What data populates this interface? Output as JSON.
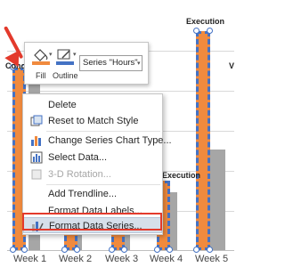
{
  "chart": {
    "categories": [
      "Week 1",
      "Week 2",
      "Week 3",
      "Week 4",
      "Week 5"
    ],
    "series_labels": [
      "Execution",
      "Execution"
    ],
    "clipped_labels": [
      "Conce",
      "V"
    ],
    "colors": {
      "hours_series": "#f08a3e",
      "gray_series": "#a6a6a6",
      "selection": "#4472c4"
    }
  },
  "mini_toolbar": {
    "fill_label": "Fill",
    "outline_label": "Outline",
    "series_select_value": "Series \"Hours\"",
    "icons": [
      "paint-bucket-icon",
      "pen-outline-icon",
      "chevron-down-icon"
    ]
  },
  "context_menu": {
    "items": [
      {
        "label": "Delete",
        "icon": "",
        "disabled": false
      },
      {
        "label": "Reset to Match Style",
        "icon": "reset-style-icon",
        "disabled": false
      },
      {
        "label": "Change Series Chart Type...",
        "icon": "chart-type-icon",
        "disabled": false
      },
      {
        "label": "Select Data...",
        "icon": "select-data-icon",
        "disabled": false
      },
      {
        "label": "3-D Rotation...",
        "icon": "rotation-3d-icon",
        "disabled": true
      },
      {
        "label": "Add Trendline...",
        "icon": "",
        "disabled": false
      },
      {
        "label": "Format Data Labels...",
        "icon": "",
        "disabled": false
      },
      {
        "label": "Format Data Series...",
        "icon": "format-series-icon",
        "disabled": false,
        "highlighted": true
      }
    ]
  }
}
